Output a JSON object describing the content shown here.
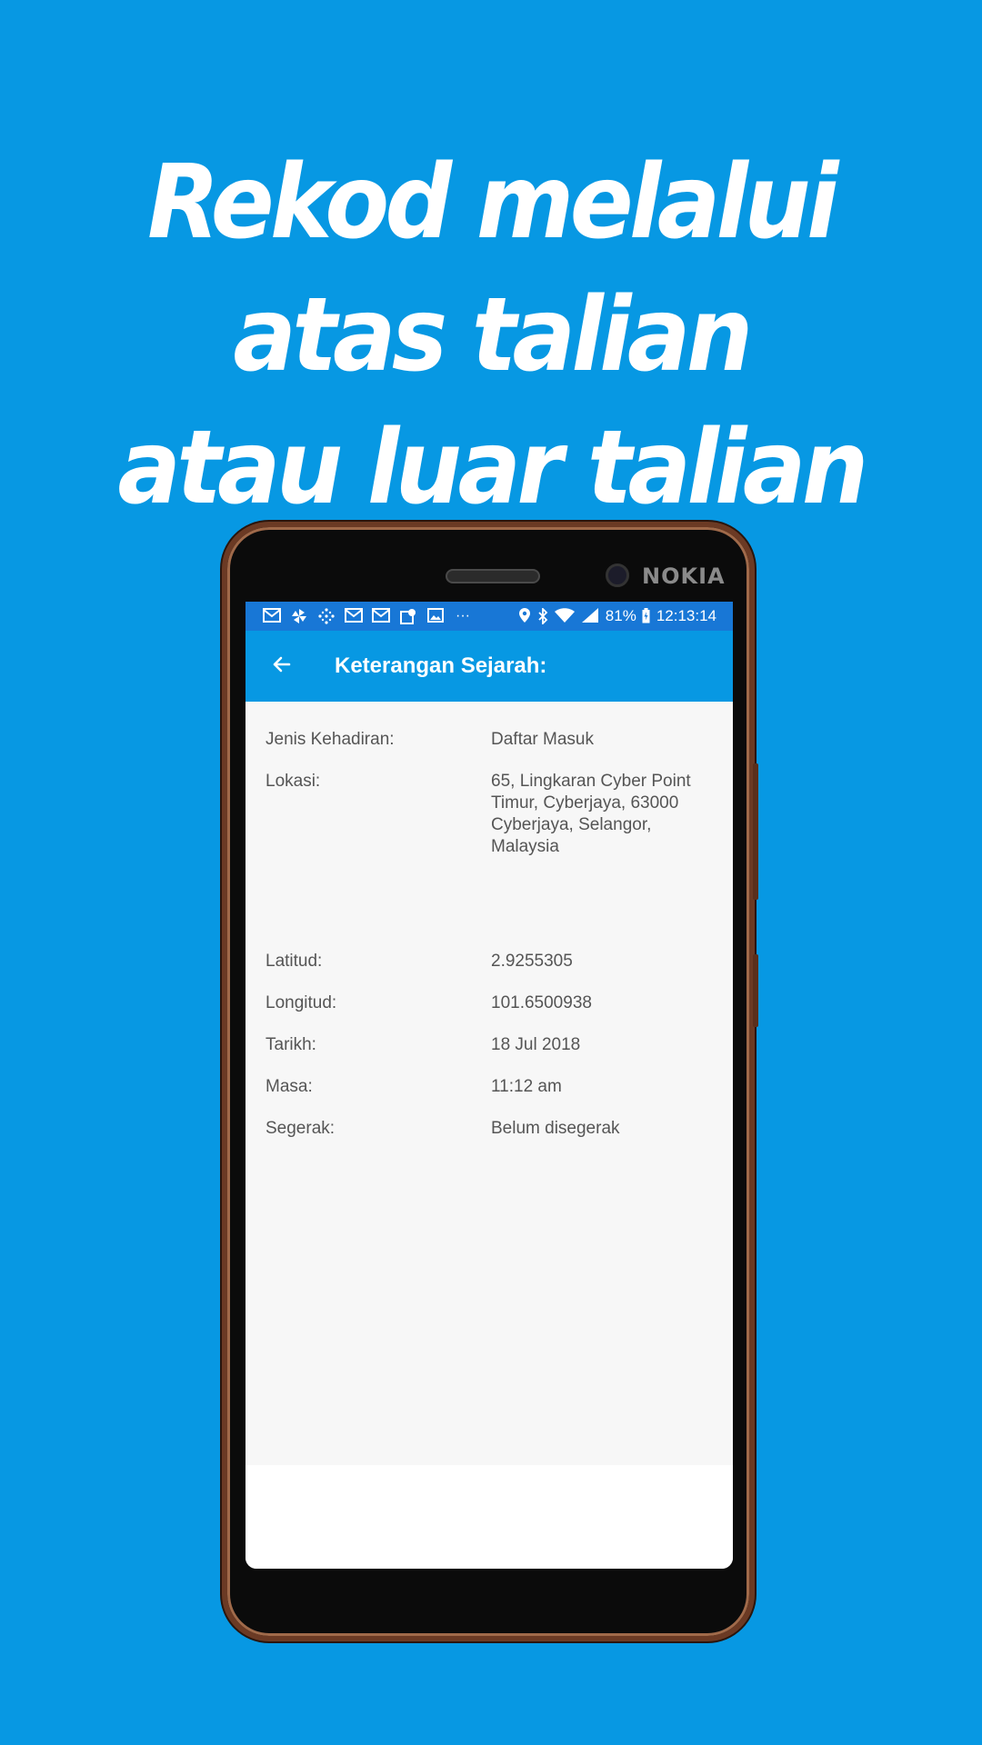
{
  "headline": {
    "line1": "Rekod melalui atas talian",
    "line2": "atau luar talian"
  },
  "device": {
    "brand": "NOKIA"
  },
  "status_bar": {
    "battery": "81%",
    "time": "12:13:14",
    "icons_left": [
      "gmail-icon",
      "pinwheel-icon",
      "grid-icon",
      "gmail-icon",
      "gmail-icon",
      "map-pin-icon",
      "image-icon",
      "more-icon"
    ],
    "icons_right": [
      "location-icon",
      "bluetooth-icon",
      "wifi-icon",
      "signal-icon",
      "battery-icon"
    ]
  },
  "app_bar": {
    "title": "Keterangan Sejarah:",
    "back_icon": "arrow-left-icon"
  },
  "details": [
    {
      "label": "Jenis Kehadiran:",
      "value": "Daftar Masuk"
    },
    {
      "label": "Lokasi:",
      "value": "65, Lingkaran Cyber Point Timur, Cyberjaya, 63000 Cyberjaya, Selangor, Malaysia"
    },
    {
      "label": "Latitud:",
      "value": "2.9255305"
    },
    {
      "label": "Longitud:",
      "value": "101.6500938"
    },
    {
      "label": "Tarikh:",
      "value": "18 Jul 2018"
    },
    {
      "label": "Masa:",
      "value": "11:12 am"
    },
    {
      "label": "Segerak:",
      "value": "Belum disegerak"
    }
  ],
  "colors": {
    "background": "#0798e3",
    "status_bar": "#1877d6",
    "app_bar": "#0798e3",
    "content_bg": "#f7f7f7",
    "text": "#555555"
  }
}
